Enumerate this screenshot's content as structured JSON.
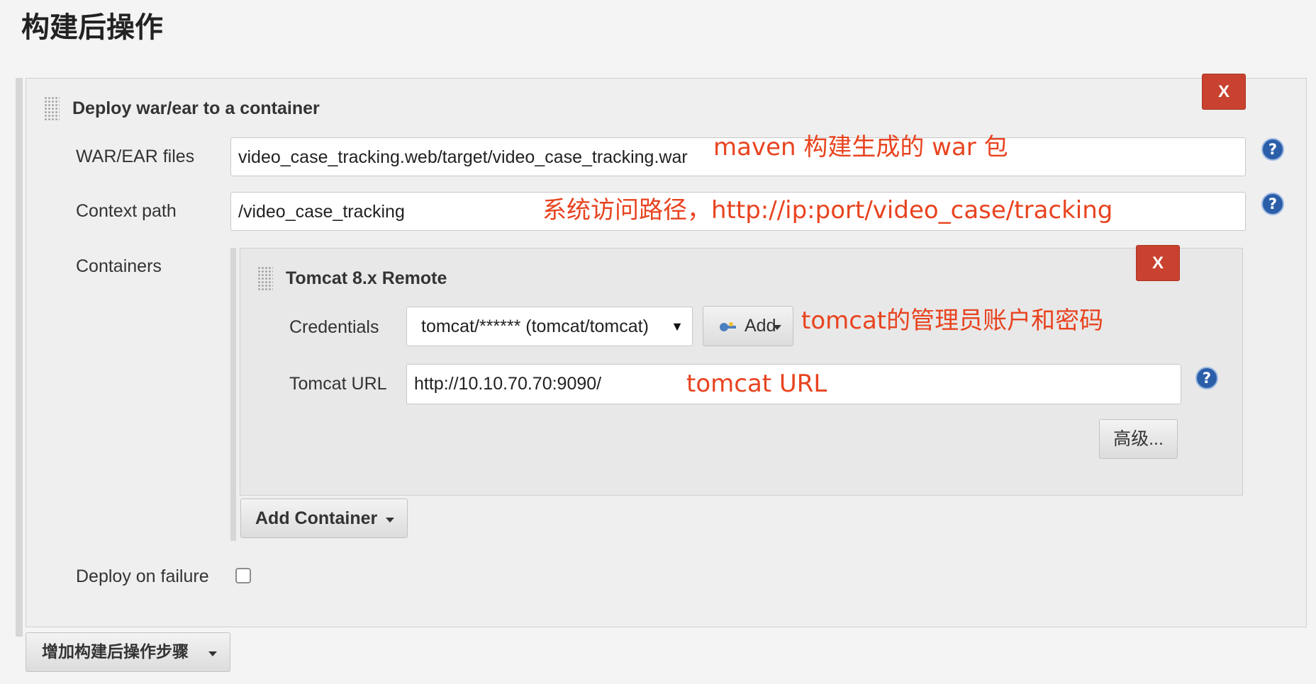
{
  "page": {
    "title": "构建后操作"
  },
  "deploy_section": {
    "title": "Deploy war/ear to a container",
    "remove_label": "X",
    "war_files": {
      "label": "WAR/EAR files",
      "value": "video_case_tracking.web/target/video_case_tracking.war"
    },
    "context_path": {
      "label": "Context path",
      "value": "/video_case_tracking"
    },
    "containers_label": "Containers",
    "deploy_on_failure": {
      "label": "Deploy on failure",
      "checked": false
    }
  },
  "container": {
    "title": "Tomcat 8.x Remote",
    "remove_label": "X",
    "credentials": {
      "label": "Credentials",
      "selected": "tomcat/****** (tomcat/tomcat)",
      "caret": "▼",
      "add_label": "Add"
    },
    "tomcat_url": {
      "label": "Tomcat URL",
      "value": "http://10.10.70.70:9090/"
    },
    "advanced_label": "高级..."
  },
  "add_container_label": "Add Container",
  "add_post_build_step_label": "增加构建后操作步骤",
  "help_icon_glyph": "?",
  "annotations": {
    "war": "maven 构建生成的 war 包",
    "context": "系统访问路径，http://ip:port/video_case/tracking",
    "credentials": "tomcat的管理员账户和密码",
    "url": "tomcat URL"
  },
  "colors": {
    "annotation": "#e8431f",
    "remove_button": "#c9422f",
    "help_icon": "#2b5ea8"
  }
}
